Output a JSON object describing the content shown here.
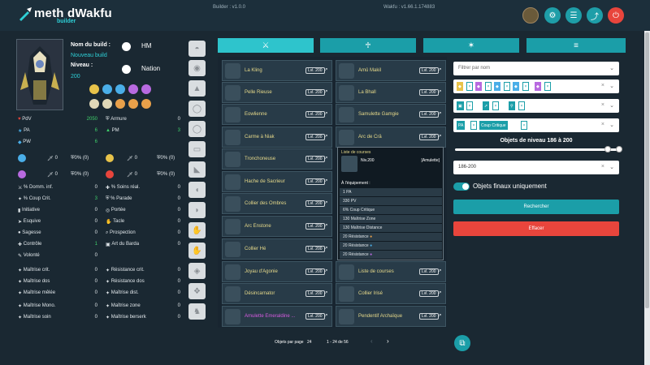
{
  "header": {
    "logo_main": "meth dWakfu",
    "logo_sub": "builder",
    "builder_version": "Builder : v1.0.0",
    "wakfu_version": "Wakfu : v1.66.1.174883"
  },
  "build": {
    "name_label": "Nom du build :",
    "name_value": "Nouveau build",
    "level_label": "Niveau :",
    "level_value": "200",
    "hm_label": "HM",
    "nation_label": "Nation"
  },
  "stats_top": [
    {
      "label": "PdV",
      "value": "2050",
      "color": "#3fd16b"
    },
    {
      "label": "PA",
      "value": "6",
      "color": "#3fd16b"
    },
    {
      "label": "PW",
      "value": "6",
      "color": "#3fd16b"
    }
  ],
  "stats_top_right": [
    {
      "label": "Armure",
      "value": "0"
    },
    {
      "label": "PM",
      "value": "3",
      "color": "#3fd16b"
    }
  ],
  "resist_rows": [
    {
      "a": "0",
      "b": "0% (0)",
      "c": "0",
      "d": "0% (0)"
    },
    {
      "a": "0",
      "b": "0% (0)",
      "c": "0",
      "d": "0% (0)"
    }
  ],
  "stats_mid_left": [
    {
      "label": "% Domm. inf.",
      "value": "0"
    },
    {
      "label": "% Coup Crit.",
      "value": "3",
      "color": "#3fd16b"
    },
    {
      "label": "Initiative",
      "value": "0"
    },
    {
      "label": "Esquive",
      "value": "0"
    },
    {
      "label": "Sagesse",
      "value": "0"
    },
    {
      "label": "Contrôle",
      "value": "1",
      "color": "#3fd16b"
    },
    {
      "label": "Volonté",
      "value": "0"
    }
  ],
  "stats_mid_right": [
    {
      "label": "% Soins réal.",
      "value": "0"
    },
    {
      "label": "% Parade",
      "value": "0"
    },
    {
      "label": "Portée",
      "value": "0"
    },
    {
      "label": "Tacle",
      "value": "0"
    },
    {
      "label": "Prospection",
      "value": "0"
    },
    {
      "label": "Art du Barda",
      "value": "0"
    }
  ],
  "stats_bot_left": [
    {
      "label": "Maîtrise crit.",
      "value": "0"
    },
    {
      "label": "Maîtrise dos",
      "value": "0"
    },
    {
      "label": "Maîtrise mêlée",
      "value": "0"
    },
    {
      "label": "Maîtrise Mono.",
      "value": "0"
    },
    {
      "label": "Maîtrise soin",
      "value": "0"
    }
  ],
  "stats_bot_right": [
    {
      "label": "Résistance crit.",
      "value": "0"
    },
    {
      "label": "Résistance dos",
      "value": "0"
    },
    {
      "label": "Maîtrise dist.",
      "value": "0"
    },
    {
      "label": "Maîtrise zone",
      "value": "0"
    },
    {
      "label": "Maîtrise berserk",
      "value": "0"
    }
  ],
  "items_left": [
    {
      "name": "La Kling",
      "level": "Lvl. 200",
      "color": "#e6d98a"
    },
    {
      "name": "Pelle Rieuse",
      "level": "Lvl. 200",
      "color": "#e6d98a"
    },
    {
      "name": "Eowlienne",
      "level": "Lvl. 200",
      "color": "#e6d98a"
    },
    {
      "name": "Carme à Niak",
      "level": "Lvl. 200",
      "color": "#e6d98a"
    },
    {
      "name": "Tronchoneuse",
      "level": "Lvl. 200",
      "color": "#e6d98a"
    },
    {
      "name": "Hache de Sacrieur",
      "level": "Lvl. 200",
      "color": "#e6d98a"
    },
    {
      "name": "Collier des Ombres",
      "level": "Lvl. 200",
      "color": "#e6d98a"
    },
    {
      "name": "Arc Enstone",
      "level": "Lvl. 200",
      "color": "#e6d98a"
    },
    {
      "name": "Collier Hé",
      "level": "Lvl. 200",
      "color": "#e6d98a"
    },
    {
      "name": "Joyau d'Agonie",
      "level": "Lvl. 200",
      "color": "#e6d98a"
    },
    {
      "name": "Désincarnator",
      "level": "Lvl. 200",
      "color": "#e6d98a"
    },
    {
      "name": "Amulette Emeraldine ...",
      "level": "Lvl. 200",
      "color": "#d65be0"
    }
  ],
  "items_right": [
    {
      "name": "Amû Makil",
      "level": "Lvl. 200",
      "color": "#e6d98a"
    },
    {
      "name": "La Bhall",
      "level": "Lvl. 200",
      "color": "#e6d98a"
    },
    {
      "name": "Samulette Gamgie",
      "level": "Lvl. 200",
      "color": "#e6d98a"
    },
    {
      "name": "Arc de Crâ",
      "level": "Lvl. 200",
      "color": "#e6d98a"
    },
    {
      "name": "Liste de courses",
      "level": "Lvl. 200",
      "color": "#e6d98a"
    },
    {
      "name": "Collier Irisé",
      "level": "Lvl. 200",
      "color": "#e6d98a"
    },
    {
      "name": "Pendentif Archaïque",
      "level": "Lvl. 200",
      "color": "#e6d98a"
    }
  ],
  "tooltip": {
    "title": "Liste de courses",
    "level": "Niv.200",
    "type": "[Amulette]",
    "equip_label": "À l'équipement :",
    "effects": [
      "1 PA",
      "330 PV",
      "6% Coup Critique",
      "130 Maîtrise Zone",
      "130 Maîtrise Distance",
      "20 Résistance",
      "20 Résistance",
      "20 Résistance"
    ]
  },
  "pagination": {
    "per_page_label": "Objets par page",
    "per_page_value": "24",
    "range": "1 - 24 de 56"
  },
  "filters": {
    "name_placeholder": "Filtrer par nom",
    "chips_stats": [
      "PA",
      "Coup Critique"
    ],
    "level_label": "Objets de niveau 186 à 200",
    "level_min": 186,
    "level_max": 200,
    "level_select": "186-200",
    "final_only": "Objets finaux uniquement",
    "search_btn": "Rechercher",
    "clear_btn": "Effacer",
    "search_color": "#1b9ea8",
    "clear_color": "#e8453c"
  }
}
